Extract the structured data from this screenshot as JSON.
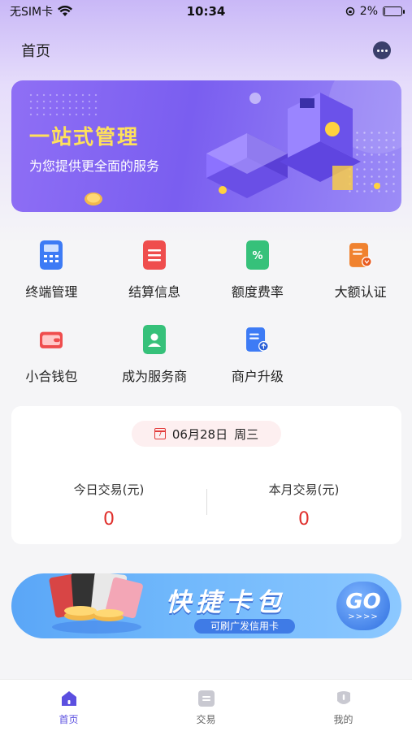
{
  "status_bar": {
    "carrier": "无SIM卡",
    "time": "10:34",
    "battery": "2%",
    "battery_level": 0.02
  },
  "nav": {
    "title": "首页",
    "message_icon": "chat-bubble-icon"
  },
  "banner": {
    "title": "一站式管理",
    "subtitle": "为您提供更全面的服务"
  },
  "grid": {
    "items": [
      {
        "label": "终端管理",
        "icon": "terminal-icon",
        "color": "#3d7bf5"
      },
      {
        "label": "结算信息",
        "icon": "settlement-icon",
        "color": "#ef4d4d"
      },
      {
        "label": "额度费率",
        "icon": "rate-icon",
        "color": "#36c17a"
      },
      {
        "label": "大额认证",
        "icon": "certify-icon",
        "color": "#f0822f"
      },
      {
        "label": "小合钱包",
        "icon": "wallet-icon",
        "color": "#ef4d4d"
      },
      {
        "label": "成为服务商",
        "icon": "provider-icon",
        "color": "#36c17a"
      },
      {
        "label": "商户升级",
        "icon": "upgrade-icon",
        "color": "#3d7bf5"
      }
    ]
  },
  "stats": {
    "date": "06月28日",
    "weekday": "周三",
    "calendar_day": "7",
    "today_label": "今日交易(元)",
    "today_value": "0",
    "month_label": "本月交易(元)",
    "month_value": "0"
  },
  "wallet": {
    "title": "快捷卡包",
    "subtitle": "可刷广发信用卡",
    "go_label": "GO",
    "go_arrows": ">>>>"
  },
  "tabs": [
    {
      "label": "首页",
      "icon": "home-icon",
      "active": true
    },
    {
      "label": "交易",
      "icon": "transaction-icon",
      "active": false
    },
    {
      "label": "我的",
      "icon": "profile-icon",
      "active": false
    }
  ],
  "colors": {
    "accent": "#5b4fe0",
    "value_red": "#e0302c",
    "banner_yellow": "#ffe15b"
  }
}
